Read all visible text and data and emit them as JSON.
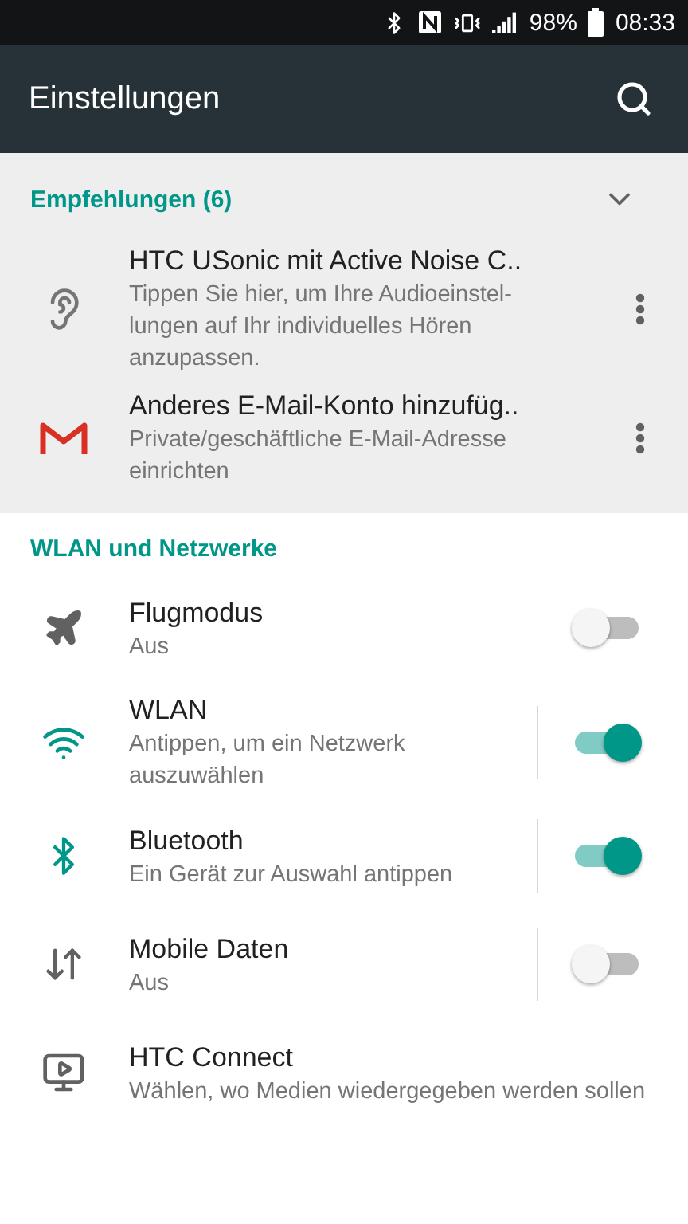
{
  "status_bar": {
    "battery": "98%",
    "time": "08:33"
  },
  "app_bar": {
    "title": "Einstellungen"
  },
  "suggestions": {
    "title": "Empfehlungen (6)",
    "expanded": true,
    "items": [
      {
        "kind": "ear",
        "title": "HTC USonic mit Active Noise C..",
        "summary": "Tippen Sie hier, um Ihre Audioeinstel-lungen auf Ihr individuelles Hören anzupassen."
      },
      {
        "kind": "mail",
        "title": "Anderes E-Mail-Konto hinzufüg..",
        "summary": "Private/geschäftliche E-Mail-Adresse einrichten"
      }
    ]
  },
  "section": {
    "title": "WLAN und Netzwerke",
    "items": [
      {
        "kind": "plane",
        "title": "Flugmodus",
        "summary": "Aus",
        "on": false,
        "split": false
      },
      {
        "kind": "wifi",
        "title": "WLAN",
        "summary": "Antippen, um ein Netzwerk auszuwählen",
        "on": true,
        "split": true
      },
      {
        "kind": "bluetooth",
        "title": "Bluetooth",
        "summary": "Ein Gerät zur Auswahl antippen",
        "on": true,
        "split": true
      },
      {
        "kind": "data",
        "title": "Mobile Daten",
        "summary": "Aus",
        "on": false,
        "split": true
      },
      {
        "kind": "cast",
        "title": "HTC Connect",
        "summary": "Wählen, wo Medien wiedergegeben werden sollen"
      }
    ]
  }
}
